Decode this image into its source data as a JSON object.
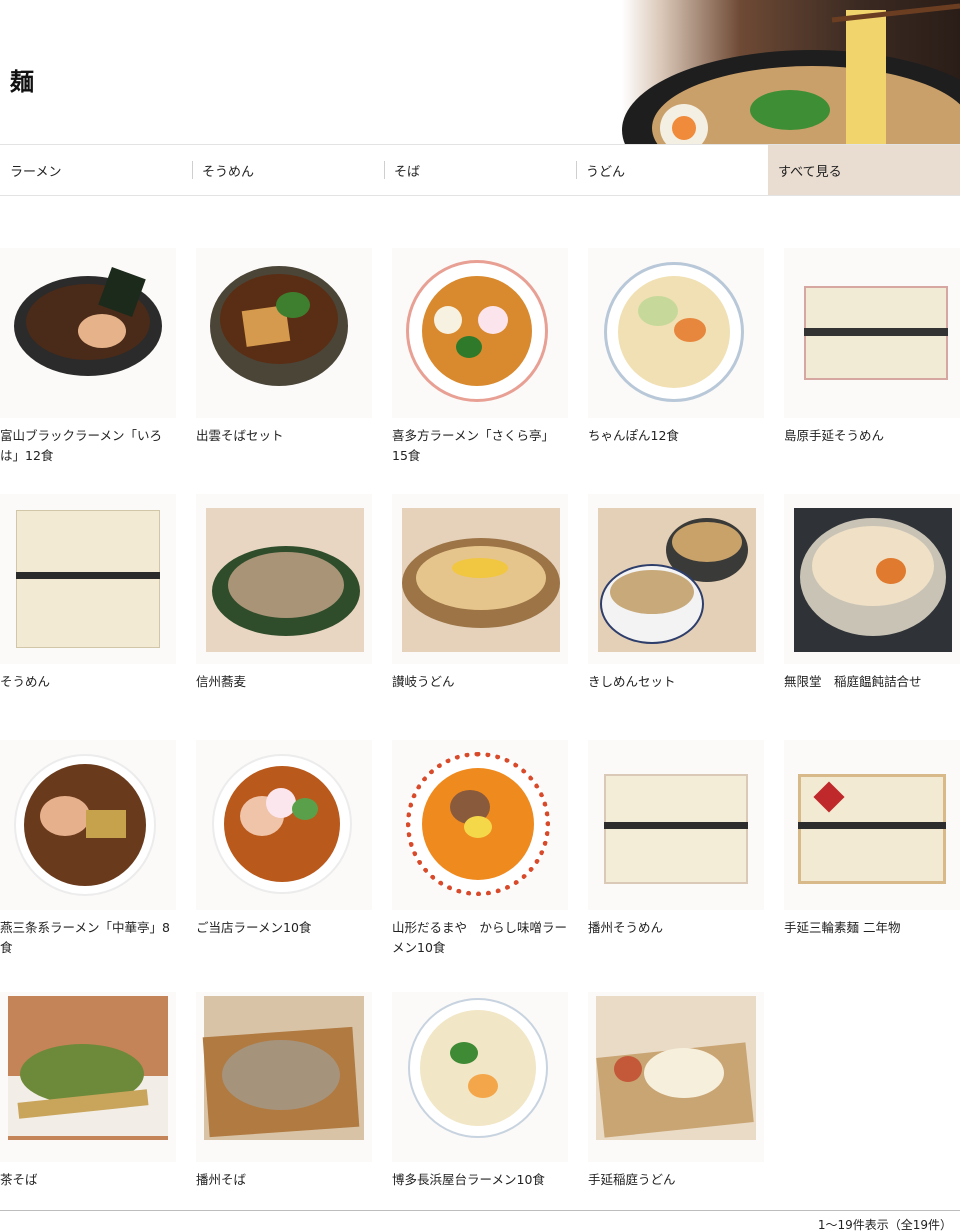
{
  "page": {
    "title": "麺"
  },
  "tabs": [
    {
      "label": "ラーメン"
    },
    {
      "label": "そうめん"
    },
    {
      "label": "そば"
    },
    {
      "label": "うどん"
    },
    {
      "label": "すべて見る"
    }
  ],
  "products": [
    {
      "name": "富山ブラックラーメン「いろは」12食"
    },
    {
      "name": "出雲そばセット"
    },
    {
      "name": "喜多方ラーメン「さくら亭」15食"
    },
    {
      "name": "ちゃんぽん12食"
    },
    {
      "name": "島原手延そうめん"
    },
    {
      "name": "そうめん"
    },
    {
      "name": "信州蕎麦"
    },
    {
      "name": "讃岐うどん"
    },
    {
      "name": "きしめんセット"
    },
    {
      "name": "無限堂　稲庭饂飩詰合せ"
    },
    {
      "name": "燕三条系ラーメン「中華亭」8食"
    },
    {
      "name": "ご当店ラーメン10食"
    },
    {
      "name": "山形だるまや　からし味噌ラーメン10食"
    },
    {
      "name": "播州そうめん"
    },
    {
      "name": "手延三輪素麺 二年物"
    },
    {
      "name": "茶そば"
    },
    {
      "name": "播州そば"
    },
    {
      "name": "博多長浜屋台ラーメン10食"
    },
    {
      "name": "手延稲庭うどん"
    }
  ],
  "pagination": {
    "summary": "1～19件表示（全19件）"
  },
  "colors": {
    "active_tab_bg": "#e9dcd0",
    "border": "#e3e3e3"
  }
}
